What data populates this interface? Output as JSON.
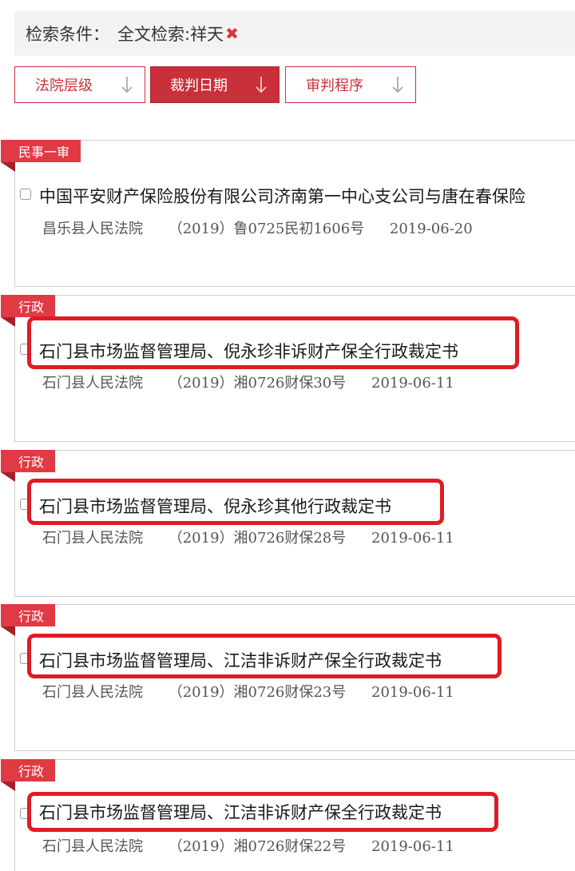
{
  "search": {
    "label": "检索条件：",
    "value": "全文检索:祥天",
    "remove_icon": "✖"
  },
  "sort": [
    {
      "label": "法院层级",
      "active": false
    },
    {
      "label": "裁判日期",
      "active": true
    },
    {
      "label": "审判程序",
      "active": false
    }
  ],
  "results": [
    {
      "tag": "民事一审",
      "title": "中国平安财产保险股份有限公司济南第一中心支公司与唐在春保险",
      "court": "昌乐县人民法院",
      "case_no": "（2019）鲁0725民初1606号",
      "date": "2019-06-20",
      "highlighted": false
    },
    {
      "tag": "行政",
      "title": "石门县市场监督管理局、倪永珍非诉财产保全行政裁定书",
      "court": "石门县人民法院",
      "case_no": "（2019）湘0726财保30号",
      "date": "2019-06-11",
      "highlighted": true
    },
    {
      "tag": "行政",
      "title": "石门县市场监督管理局、倪永珍其他行政裁定书",
      "court": "石门县人民法院",
      "case_no": "（2019）湘0726财保28号",
      "date": "2019-06-11",
      "highlighted": true
    },
    {
      "tag": "行政",
      "title": "石门县市场监督管理局、江洁非诉财产保全行政裁定书",
      "court": "石门县人民法院",
      "case_no": "（2019）湘0726财保23号",
      "date": "2019-06-11",
      "highlighted": true
    },
    {
      "tag": "行政",
      "title": "石门县市场监督管理局、江洁非诉财产保全行政裁定书",
      "court": "石门县人民法院",
      "case_no": "（2019）湘0726财保22号",
      "date": "2019-06-11",
      "highlighted": true
    }
  ],
  "colors": {
    "accent": "#c9303a",
    "tag": "#e03a45",
    "highlight": "#e01b24"
  }
}
